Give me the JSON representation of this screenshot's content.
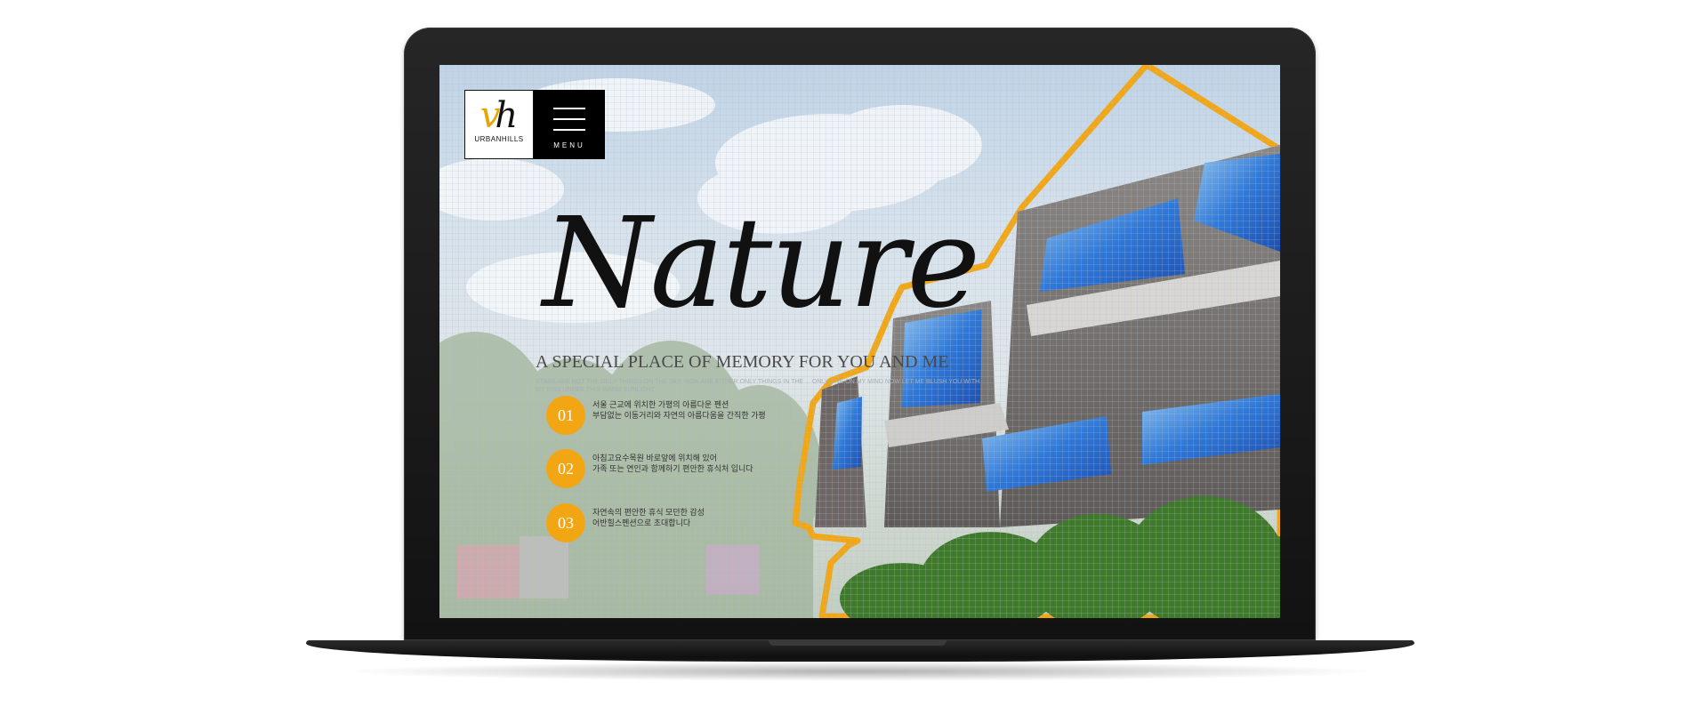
{
  "brand": {
    "logo_word": "URBANHILLS",
    "accent_color": "#f2a613",
    "outline_color": "#f2a613"
  },
  "nav": {
    "menu_label": "MENU",
    "menu_icon": "hamburger-icon"
  },
  "hero": {
    "title": "Nature",
    "tagline": "A SPECIAL PLACE OF MEMORY FOR YOU AND ME",
    "subcopy": "STARS ARE NOT THE ONLY THINGS ON THE SKY, NOW ARE EITHER ONLY THINGS IN THE ... ONLY ONE ON MY MIND NOW LET ME BLUSH YOU WITH MY KISS UNDER THIS WARM SUNLIGHT"
  },
  "features": [
    {
      "number": "01",
      "line1": "서울 근교에 위치한 가평의 아름다운 펜션",
      "line2": "부담없는 이동거리와 자연의 아름다움을 간직한 가평"
    },
    {
      "number": "02",
      "line1": "아침고요수목원 바로앞에 위치해 있어",
      "line2": "가족 또는 연인과 함께하기 편안한 휴식처 입니다"
    },
    {
      "number": "03",
      "line1": "자연속의 편안한 휴식 모던한 감성",
      "line2": "어반힐스펜션으로 초대합니다"
    }
  ]
}
